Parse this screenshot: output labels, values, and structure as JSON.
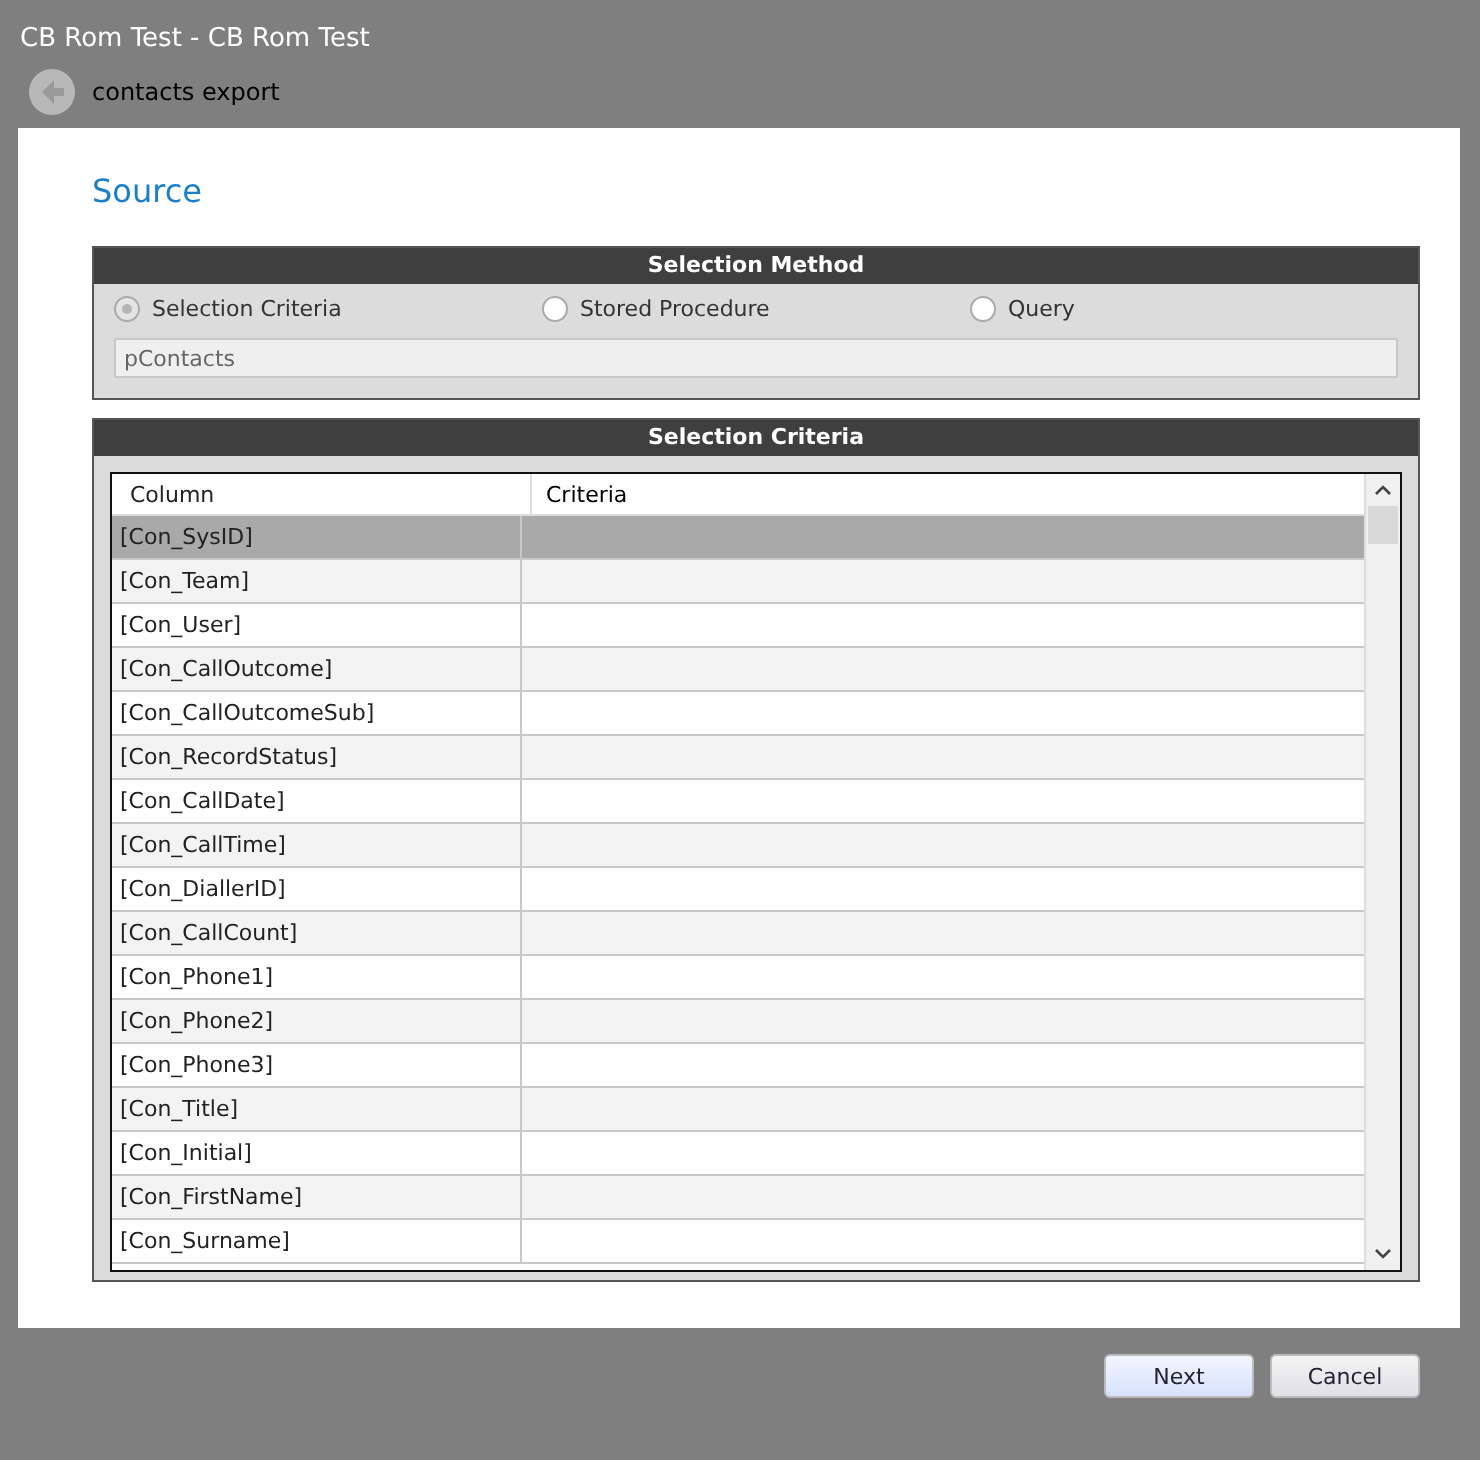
{
  "window": {
    "title": "CB Rom Test - CB Rom Test"
  },
  "breadcrumb": {
    "label": "contacts export"
  },
  "page": {
    "heading": "Source"
  },
  "selection_method": {
    "title": "Selection Method",
    "options": [
      {
        "label": "Selection Criteria",
        "selected": true
      },
      {
        "label": "Stored Procedure",
        "selected": false
      },
      {
        "label": "Query",
        "selected": false
      }
    ],
    "field": {
      "value": "pContacts"
    }
  },
  "selection_criteria": {
    "title": "Selection Criteria",
    "columns": [
      "Column",
      "Criteria"
    ],
    "rows": [
      {
        "column": "[Con_SysID]",
        "selected": true
      },
      {
        "column": "[Con_Team]",
        "selected": false
      },
      {
        "column": "[Con_User]",
        "selected": false
      },
      {
        "column": "[Con_CallOutcome]",
        "selected": false
      },
      {
        "column": "[Con_CallOutcomeSub]",
        "selected": false
      },
      {
        "column": "[Con_RecordStatus]",
        "selected": false
      },
      {
        "column": "[Con_CallDate]",
        "selected": false
      },
      {
        "column": "[Con_CallTime]",
        "selected": false
      },
      {
        "column": "[Con_DiallerID]",
        "selected": false
      },
      {
        "column": "[Con_CallCount]",
        "selected": false
      },
      {
        "column": "[Con_Phone1]",
        "selected": false
      },
      {
        "column": "[Con_Phone2]",
        "selected": false
      },
      {
        "column": "[Con_Phone3]",
        "selected": false
      },
      {
        "column": "[Con_Title]",
        "selected": false
      },
      {
        "column": "[Con_Initial]",
        "selected": false
      },
      {
        "column": "[Con_FirstName]",
        "selected": false
      },
      {
        "column": "[Con_Surname]",
        "selected": false
      }
    ]
  },
  "buttons": [
    {
      "label": "Next",
      "kind": "primary"
    },
    {
      "label": "Cancel",
      "kind": "secondary"
    }
  ]
}
